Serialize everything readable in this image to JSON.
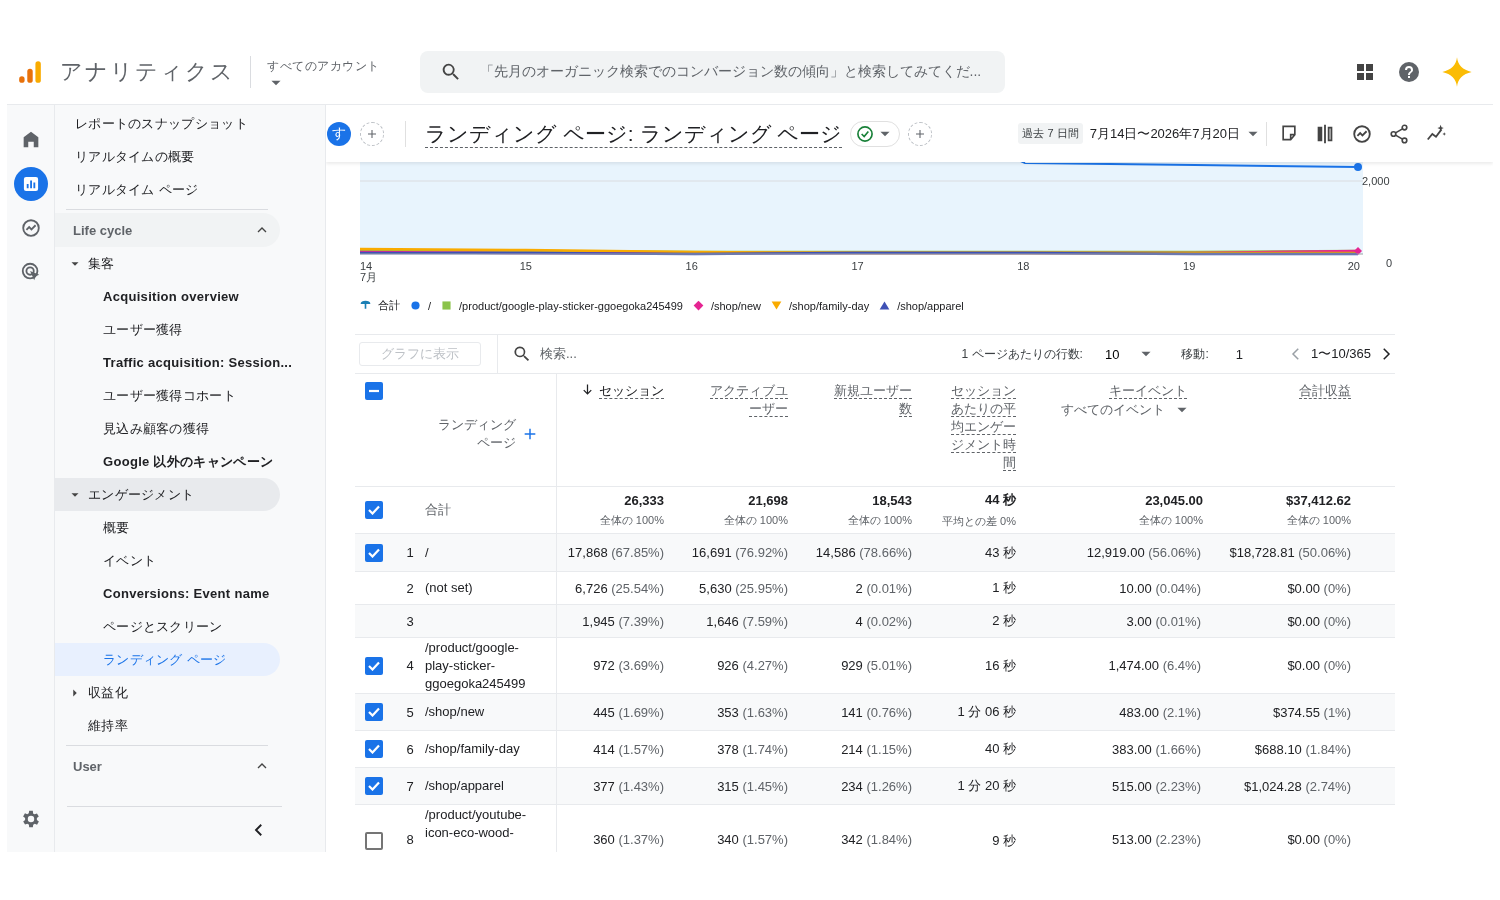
{
  "header": {
    "product": "アナリティクス",
    "account_label": "すべてのアカウント",
    "search_placeholder": "「先月のオーガニック検索でのコンバージョン数の傾向」と検索してみてくだ..."
  },
  "rail": [
    {
      "kind": "home",
      "selected": false
    },
    {
      "kind": "reports",
      "selected": true
    },
    {
      "kind": "explore",
      "selected": false
    },
    {
      "kind": "advertising",
      "selected": false
    }
  ],
  "nav": {
    "top_items": [
      {
        "label": "レポートのスナップショット",
        "selected": false
      },
      {
        "label": "リアルタイムの概要",
        "selected": false
      },
      {
        "label": "リアルタイム ページ",
        "selected": false
      }
    ],
    "sections": [
      {
        "title": "Life cycle",
        "expanded": true,
        "children": [
          {
            "label": "集客",
            "expanded": true,
            "selected": false,
            "children": [
              {
                "label": "Acquisition overview",
                "selected": false,
                "bold": true
              },
              {
                "label": "ユーザー獲得",
                "selected": false
              },
              {
                "label": "Traffic acquisition: Session...",
                "selected": false,
                "bold": true
              },
              {
                "label": "ユーザー獲得コホート",
                "selected": false
              },
              {
                "label": "見込み顧客の獲得",
                "selected": false
              },
              {
                "label": "Google 以外のキャンペーン",
                "selected": false,
                "bold": true
              }
            ]
          },
          {
            "label": "エンゲージメント",
            "expanded": true,
            "selected": false,
            "children": [
              {
                "label": "概要",
                "selected": false
              },
              {
                "label": "イベント",
                "selected": false
              },
              {
                "label": "Conversions: Event name",
                "selected": false,
                "bold": true
              },
              {
                "label": "ページとスクリーン",
                "selected": false
              },
              {
                "label": "ランディング ページ",
                "selected": true
              }
            ]
          },
          {
            "label": "収益化",
            "expanded": false,
            "selected": false
          },
          {
            "label": "維持率",
            "selected": false
          }
        ]
      },
      {
        "title": "User",
        "expanded": true
      }
    ]
  },
  "toolbar": {
    "avatar": "す",
    "title": "ランディング ページ: ランディング ページ",
    "date_label": "過去 7 日間",
    "date_range": "7月14日〜2026年7月20日"
  },
  "chart": {
    "x_labels": [
      {
        "day": "14",
        "month": "7月"
      },
      {
        "day": "15"
      },
      {
        "day": "16"
      },
      {
        "day": "17"
      },
      {
        "day": "18"
      },
      {
        "day": "19"
      },
      {
        "day": "20"
      }
    ],
    "y_labels": [
      "2,000",
      "0"
    ],
    "legend": [
      {
        "label": "合計",
        "kind": "pin",
        "color": "#1a7fb5"
      },
      {
        "label": "/",
        "kind": "circle",
        "color": "#1a73e8"
      },
      {
        "label": "/product/google-play-sticker-ggoegoka245499",
        "kind": "square",
        "color": "#8bc34a"
      },
      {
        "label": "/shop/new",
        "kind": "diamond",
        "color": "#e52592"
      },
      {
        "label": "/shop/family-day",
        "kind": "funnel",
        "color": "#f9ab00"
      },
      {
        "label": "/shop/apparel",
        "kind": "triangle",
        "color": "#3f51b5"
      }
    ]
  },
  "table": {
    "chart_button": "グラフに表示",
    "chart_button_disabled": true,
    "search_placeholder": "検索...",
    "rows_label": "1 ページあたりの行数:",
    "rows_value": "10",
    "goto_label": "移動:",
    "goto_value": "1",
    "page_range": "1〜10/365",
    "select_all_mixed": true,
    "columns": [
      {
        "label": "ランディングページ",
        "kind": "dimension"
      },
      {
        "label": "セッション",
        "kind": "metric",
        "sorted": true
      },
      {
        "label": "アクティブユーザー",
        "kind": "metric",
        "sorted": false
      },
      {
        "label": "新規ユーザー数",
        "kind": "metric",
        "sorted": false
      },
      {
        "label": "セッションあたりの平均エンゲージメント時間",
        "kind": "metric",
        "sorted": false
      },
      {
        "label": "キーイベント",
        "kind": "metric",
        "sorted": false,
        "sub": "すべてのイベント"
      },
      {
        "label": "合計収益",
        "kind": "metric",
        "sorted": false
      }
    ],
    "total": {
      "label": "合計",
      "checked": true,
      "values": [
        {
          "value": "26,333",
          "note": "全体の 100%"
        },
        {
          "value": "21,698",
          "note": "全体の 100%"
        },
        {
          "value": "18,543",
          "note": "全体の 100%"
        },
        {
          "value": "44 秒",
          "note": "平均との差 0%"
        },
        {
          "value": "23,045.00",
          "note": "全体の 100%"
        },
        {
          "value": "$37,412.62",
          "note": "全体の 100%"
        }
      ]
    },
    "rows": [
      {
        "index": "1",
        "label": "/",
        "checked": true,
        "values": [
          {
            "value": "17,868",
            "share": "(67.85%)"
          },
          {
            "value": "16,691",
            "share": "(76.92%)"
          },
          {
            "value": "14,586",
            "share": "(78.66%)"
          },
          {
            "value": "43 秒"
          },
          {
            "value": "12,919.00",
            "share": "(56.06%)"
          },
          {
            "value": "$18,728.81",
            "share": "(50.06%)"
          }
        ]
      },
      {
        "index": "2",
        "label": "(not set)",
        "values": [
          {
            "value": "6,726",
            "share": "(25.54%)"
          },
          {
            "value": "5,630",
            "share": "(25.95%)"
          },
          {
            "value": "2",
            "share": "(0.01%)"
          },
          {
            "value": "1 秒"
          },
          {
            "value": "10.00",
            "share": "(0.04%)"
          },
          {
            "value": "$0.00",
            "share": "(0%)"
          }
        ]
      },
      {
        "index": "3",
        "values": [
          {
            "value": "1,945",
            "share": "(7.39%)"
          },
          {
            "value": "1,646",
            "share": "(7.59%)"
          },
          {
            "value": "4",
            "share": "(0.02%)"
          },
          {
            "value": "2 秒"
          },
          {
            "value": "3.00",
            "share": "(0.01%)"
          },
          {
            "value": "$0.00",
            "share": "(0%)"
          }
        ]
      },
      {
        "index": "4",
        "label": "/product/google-play-sticker-ggoegoka245499",
        "checked": true,
        "values": [
          {
            "value": "972",
            "share": "(3.69%)"
          },
          {
            "value": "926",
            "share": "(4.27%)"
          },
          {
            "value": "929",
            "share": "(5.01%)"
          },
          {
            "value": "16 秒"
          },
          {
            "value": "1,474.00",
            "share": "(6.4%)"
          },
          {
            "value": "$0.00",
            "share": "(0%)"
          }
        ]
      },
      {
        "index": "5",
        "label": "/shop/new",
        "checked": true,
        "values": [
          {
            "value": "445",
            "share": "(1.69%)"
          },
          {
            "value": "353",
            "share": "(1.63%)"
          },
          {
            "value": "141",
            "share": "(0.76%)"
          },
          {
            "value": "1 分 06 秒"
          },
          {
            "value": "483.00",
            "share": "(2.1%)"
          },
          {
            "value": "$374.55",
            "share": "(1%)"
          }
        ]
      },
      {
        "index": "6",
        "label": "/shop/family-day",
        "checked": true,
        "values": [
          {
            "value": "414",
            "share": "(1.57%)"
          },
          {
            "value": "378",
            "share": "(1.74%)"
          },
          {
            "value": "214",
            "share": "(1.15%)"
          },
          {
            "value": "40 秒"
          },
          {
            "value": "383.00",
            "share": "(1.66%)"
          },
          {
            "value": "$688.10",
            "share": "(1.84%)"
          }
        ]
      },
      {
        "index": "7",
        "label": "/shop/apparel",
        "checked": true,
        "values": [
          {
            "value": "377",
            "share": "(1.43%)"
          },
          {
            "value": "315",
            "share": "(1.45%)"
          },
          {
            "value": "234",
            "share": "(1.26%)"
          },
          {
            "value": "1 分 20 秒"
          },
          {
            "value": "515.00",
            "share": "(2.23%)"
          },
          {
            "value": "$1,024.28",
            "share": "(2.74%)"
          }
        ]
      },
      {
        "index": "8",
        "label": "/product/youtube-icon-eco-wood-",
        "checked": false,
        "values": [
          {
            "value": "360",
            "share": "(1.37%)"
          },
          {
            "value": "340",
            "share": "(1.57%)"
          },
          {
            "value": "342",
            "share": "(1.84%)"
          },
          {
            "value": "9 秒"
          },
          {
            "value": "513.00",
            "share": "(2.23%)"
          },
          {
            "value": "$0.00",
            "share": "(0%)"
          }
        ]
      }
    ]
  }
}
